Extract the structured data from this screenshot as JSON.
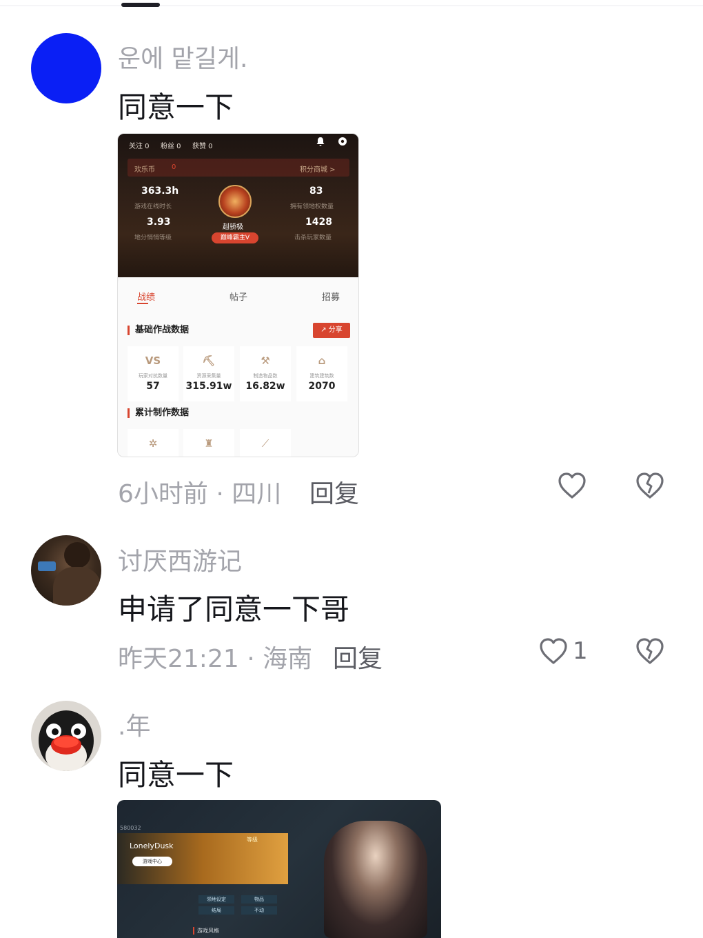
{
  "comments": [
    {
      "username": "운에 맡길게.",
      "text": "同意一下",
      "meta": "6小时前 · 四川",
      "reply_label": "回复",
      "like_count": "",
      "avatar": "blue-circle",
      "avatar_color": "#0a1ff5",
      "attachment": {
        "stats_bar": [
          "关注 0",
          "粉丝 0",
          "获赞 0"
        ],
        "coin_label": "欢乐币",
        "coin_value": "0",
        "shop_label": "积分商城 >",
        "left_stats": [
          {
            "value": "363.3h",
            "label": "游戏在线时长"
          },
          {
            "value": "3.93",
            "label": "地分悄悄等级"
          }
        ],
        "right_stats": [
          {
            "value": "83",
            "label": "拥有领地权数量"
          },
          {
            "value": "1428",
            "label": "击杀玩家数量"
          }
        ],
        "rank_name": "赳骄极",
        "rank_badge": "巅峰霸主V",
        "tabs": [
          "战绩",
          "帖子",
          "招募"
        ],
        "active_tab": "战绩",
        "section1": "基础作战数据",
        "share_label": "分享",
        "cards": [
          {
            "icon": "VS",
            "label": "玩家对抗数量",
            "value": "57"
          },
          {
            "icon": "⛏",
            "label": "资源采集量",
            "value": "315.91w"
          },
          {
            "icon": "⚒",
            "label": "制造物品数",
            "value": "16.82w"
          },
          {
            "icon": "⌂",
            "label": "建筑建筑数",
            "value": "2070"
          }
        ],
        "section2": "累计制作数据"
      }
    },
    {
      "username": "讨厌西游记",
      "text": "申请了同意一下哥",
      "meta": "昨天21:21 · 海南",
      "reply_label": "回复",
      "like_count": "1",
      "avatar": "photo"
    },
    {
      "username": ".年",
      "text": "同意一下",
      "avatar": "penguin",
      "attachment": {
        "player_id": "580032",
        "player_name": "LonelyDusk",
        "tag": "游戏中心",
        "level": "等级",
        "buttons": [
          "领地设定",
          "物品",
          "结局",
          "不动"
        ],
        "section": "游戏风格"
      }
    }
  ],
  "icons": {
    "like": "heart-outline-icon",
    "dislike": "broken-heart-icon"
  },
  "colors": {
    "muted_text": "#a3a4ab",
    "main_text": "#16171c",
    "accent_red": "#d8452f"
  }
}
